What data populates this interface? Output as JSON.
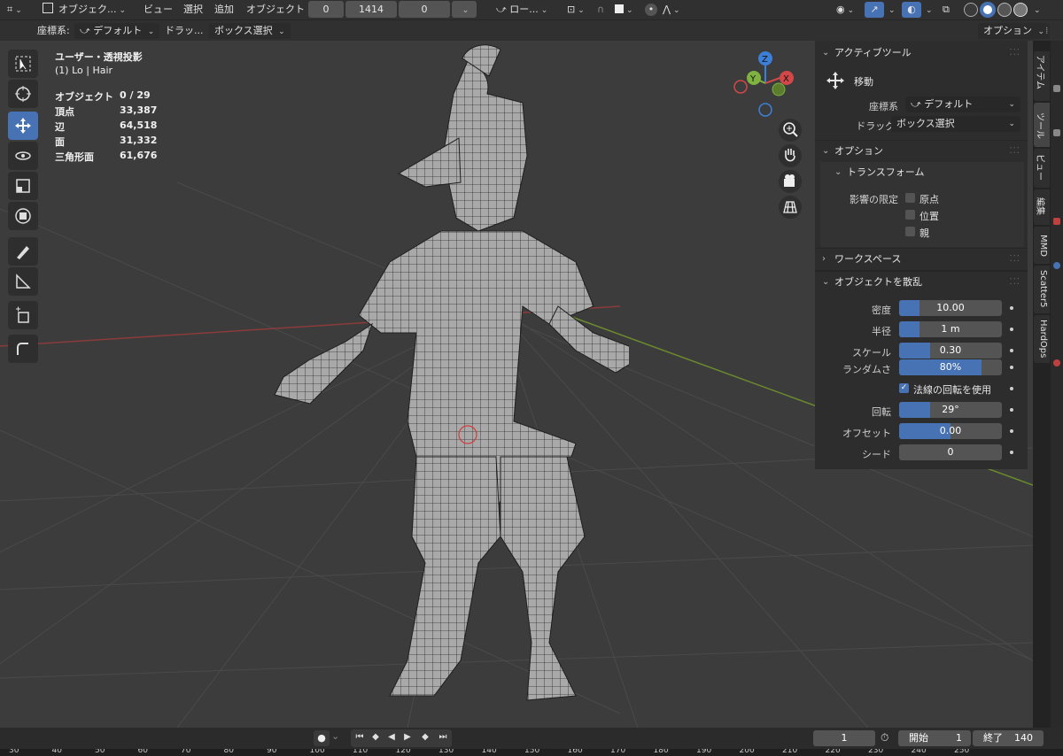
{
  "header": {
    "mode_label": "オブジェク...",
    "menu": [
      "ビュー",
      "選択",
      "追加",
      "オブジェクト"
    ],
    "fields": [
      "0",
      "1414",
      "0"
    ],
    "pivot_label": "ロー..."
  },
  "toolsettings": {
    "coord_label": "座標系:",
    "coord_value": "デフォルト",
    "drag_label": "ドラッ...",
    "drag_value": "ボックス選択",
    "options_label": "オプション"
  },
  "viewport": {
    "view_name": "ユーザー・透視投影",
    "collection": "(1) Lo | Hair",
    "stats": [
      {
        "label": "オブジェクト",
        "value": "0 / 29"
      },
      {
        "label": "頂点",
        "value": "33,387"
      },
      {
        "label": "辺",
        "value": "64,518"
      },
      {
        "label": "面",
        "value": "31,332"
      },
      {
        "label": "三角形面",
        "value": "61,676"
      }
    ],
    "gizmo_axes": [
      "Z",
      "Y",
      "X"
    ]
  },
  "npanel": {
    "active_tool": {
      "title": "アクティブツール",
      "tool_name": "移動",
      "coord_label": "座標系",
      "coord_value": "デフォルト",
      "drag_label": "ドラッグ:",
      "drag_value": "ボックス選択"
    },
    "options": {
      "title": "オプション",
      "transform_title": "トランスフォーム",
      "affect_label": "影響の限定",
      "affect_items": [
        "原点",
        "位置",
        "親"
      ]
    },
    "workspace_title": "ワークスペース",
    "scatter": {
      "title": "オブジェクトを散乱",
      "density": {
        "label": "密度",
        "value": "10.00",
        "fill": 0.2
      },
      "radius": {
        "label": "半径",
        "value": "1 m",
        "fill": 0.2
      },
      "scale": {
        "label": "スケール",
        "value": "0.30",
        "fill": 0.3
      },
      "randomness": {
        "label": "ランダムさ",
        "value": "80%",
        "fill": 0.8
      },
      "normal_rotation": {
        "label": "法線の回転を使用",
        "checked": true
      },
      "rotation": {
        "label": "回転",
        "value": "29°",
        "fill": 0.3
      },
      "offset": {
        "label": "オフセット",
        "value": "0.00",
        "fill": 0.5
      },
      "seed": {
        "label": "シード",
        "value": "0",
        "fill": 0
      }
    }
  },
  "side_tabs": [
    "アイテム",
    "ツール",
    "ビュー",
    "編集",
    "MMD",
    "Scatter5",
    "HardOps"
  ],
  "timeline": {
    "current_frame": "1",
    "start_label": "開始",
    "start_value": "1",
    "end_label": "終了",
    "end_value": "140"
  },
  "ruler_ticks": [
    "30",
    "40",
    "50",
    "60",
    "70",
    "80",
    "90",
    "100",
    "110",
    "120",
    "130",
    "140",
    "150",
    "160",
    "170",
    "180",
    "190",
    "200",
    "210",
    "220",
    "230",
    "240",
    "250"
  ]
}
